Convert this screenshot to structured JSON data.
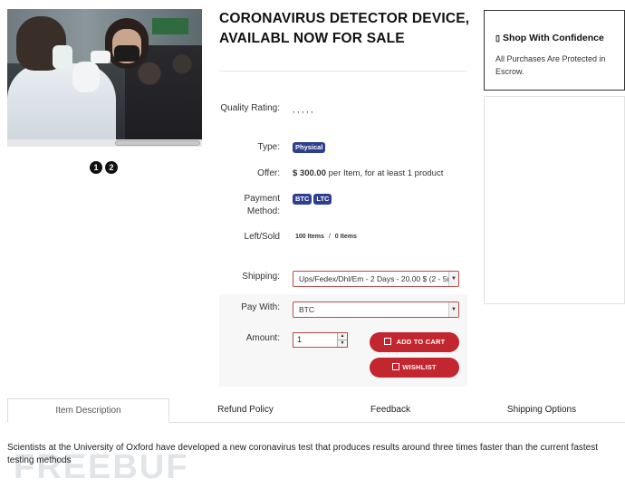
{
  "product": {
    "title": "CORONAVIRUS DETECTOR DEVICE, AVAILABL NOW FOR SALE",
    "image_pages": [
      "1",
      "2"
    ]
  },
  "details": {
    "quality_label": "Quality Rating:",
    "quality_value": ", , , , ,",
    "type_label": "Type:",
    "type_badge": "Physical",
    "offer_label": "Offer:",
    "offer_price": "$ 300.00",
    "offer_suffix": " per Item, for at least 1 product",
    "payment_label": "Payment Method:",
    "payment_badges": [
      "BTC",
      "LTC"
    ],
    "leftsold_label": "Left/Sold",
    "left_value": "100 Items",
    "sold_value": "0 Items",
    "shipping_label": "Shipping:",
    "shipping_selected": "Ups/Fedex/Dhl/Em - 2 Days - 20.00 $ (2 - 5(",
    "paywith_label": "Pay With:",
    "paywith_selected": "BTC",
    "amount_label": "Amount:",
    "amount_value": "1",
    "add_to_cart": "ADD TO CART",
    "wishlist": "WISHLIST"
  },
  "confidence": {
    "title": "Shop With Confidence",
    "text": "All Purchases Are Protected in Escrow."
  },
  "tabs": [
    "Item Description",
    "Refund Policy",
    "Feedback",
    "Shipping Options"
  ],
  "description": "Scientists at the University of Oxford have developed a new coronavirus test that produces results around three times faster than the current fastest testing methods",
  "watermark": "FREEBUF",
  "colors": {
    "accent": "#c2262e",
    "badge": "#2f3f8f"
  }
}
